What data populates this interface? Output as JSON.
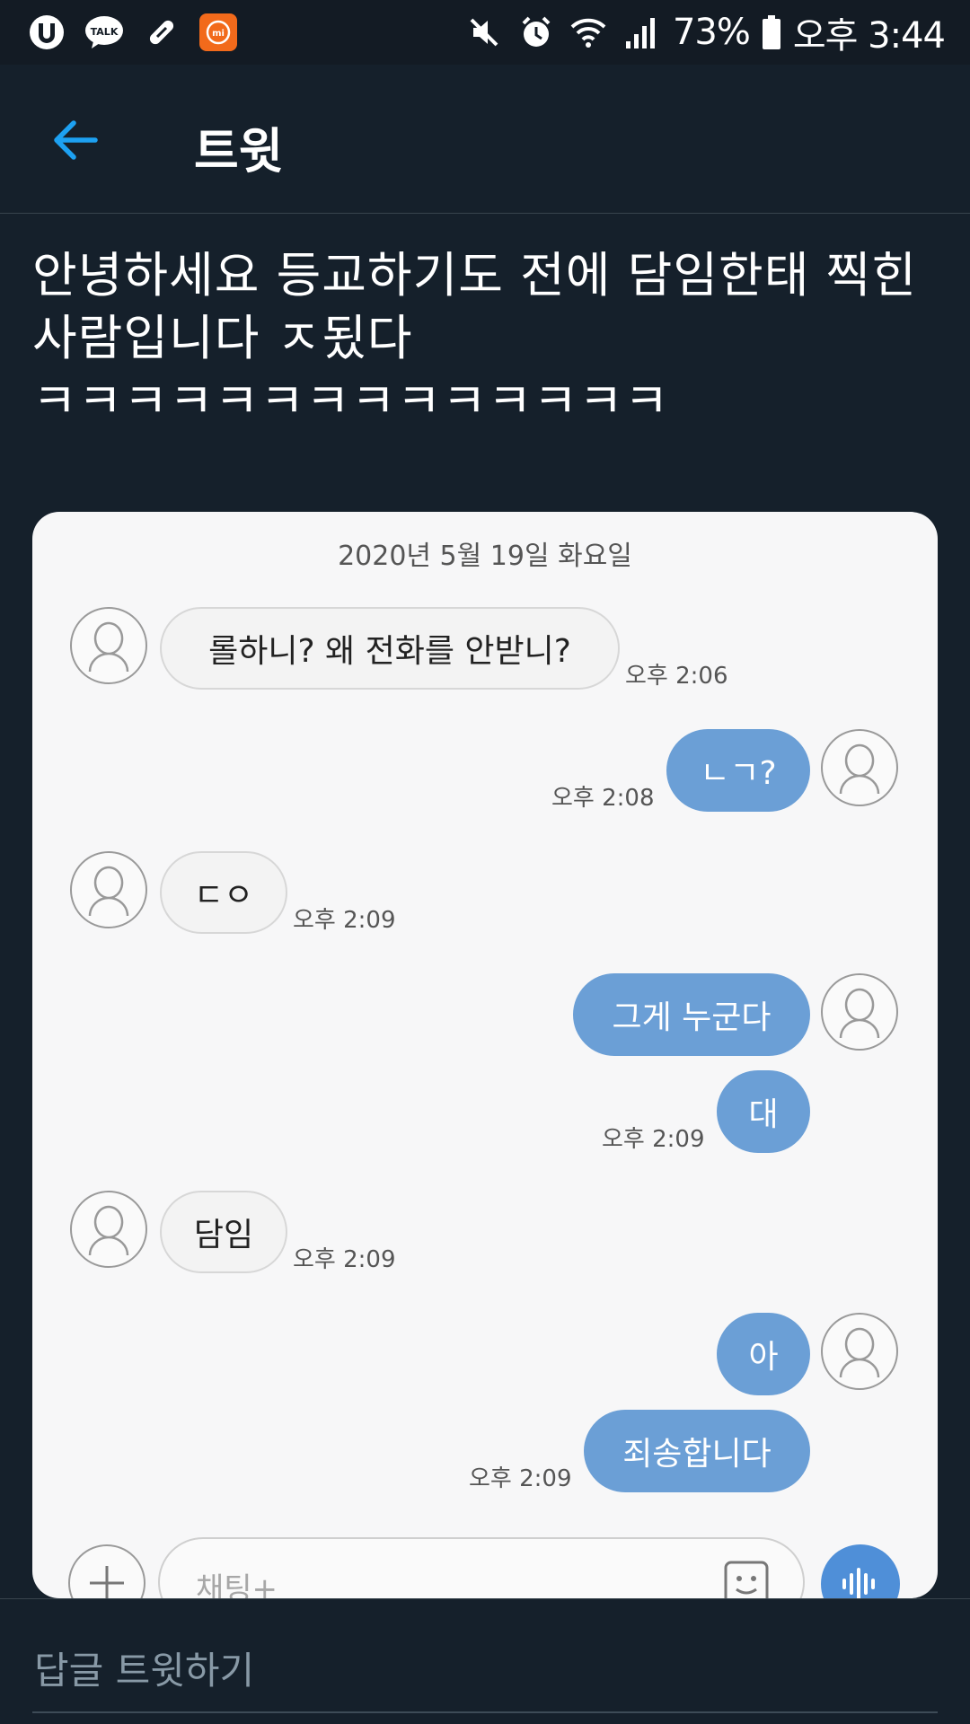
{
  "status_bar": {
    "left_icons": [
      "u-plus-icon",
      "kakaotalk-icon",
      "pill-icon",
      "mi-icon"
    ],
    "talk_label": "TALK",
    "mi_label": "mi",
    "right_icons": [
      "mute-icon",
      "alarm-icon",
      "wifi-icon",
      "signal-icon",
      "battery-icon"
    ],
    "battery": "73%",
    "time": "오후 3:44"
  },
  "header": {
    "title": "트윗"
  },
  "tweet": {
    "text": "안녕하세요 등교하기도 전에 담임한태 찍힌 사람입니다 ㅈ됬다\nㅋㅋㅋㅋㅋㅋㅋㅋㅋㅋㅋㅋㅋㅋ"
  },
  "chat": {
    "date": "2020년 5월 19일 화요일",
    "messages": [
      {
        "side": "in",
        "text": "롤하니? 왜 전화를 안받니?",
        "time": "오후 2:06"
      },
      {
        "side": "out",
        "text": "ㄴㄱ?",
        "time": "오후 2:08"
      },
      {
        "side": "in",
        "text": "ㄷㅇ",
        "time": "오후 2:09"
      },
      {
        "side": "out",
        "text": "그게 누군다",
        "time": ""
      },
      {
        "side": "out",
        "text": "대",
        "time": "오후 2:09"
      },
      {
        "side": "in",
        "text": "담임",
        "time": "오후 2:09"
      },
      {
        "side": "out",
        "text": "아",
        "time": ""
      },
      {
        "side": "out",
        "text": "죄송합니다",
        "time": "오후 2:09"
      }
    ],
    "input_placeholder": "채팅+"
  },
  "reply": {
    "placeholder": "답글 트윗하기"
  },
  "colors": {
    "background": "#15202b",
    "accent": "#1da1f2",
    "outgoing_bubble": "#6b9fd6",
    "incoming_bubble": "#f3f3f3"
  }
}
